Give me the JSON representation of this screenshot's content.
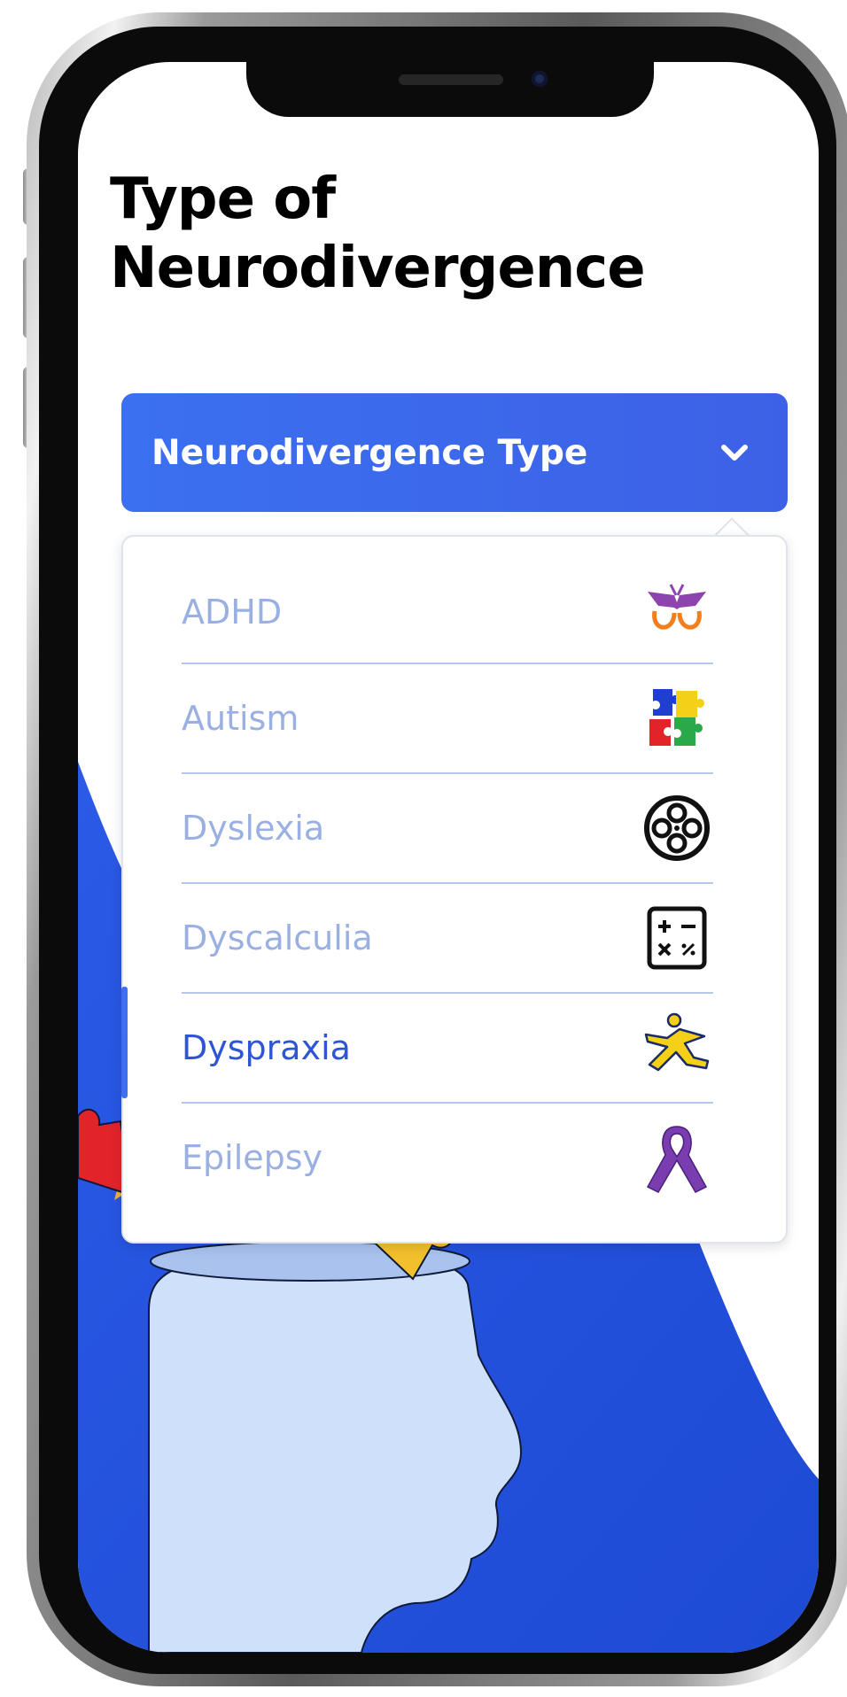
{
  "page": {
    "title": "Type of Neurodivergence"
  },
  "dropdown": {
    "label": "Neurodivergence Type",
    "state": "expanded",
    "icon": "chevron-down-icon"
  },
  "options": [
    {
      "label": "ADHD",
      "icon": "butterfly-icon",
      "selected": false
    },
    {
      "label": "Autism",
      "icon": "puzzle-pieces-icon",
      "selected": false
    },
    {
      "label": "Dyslexia",
      "icon": "film-reel-icon",
      "selected": false
    },
    {
      "label": "Dyscalculia",
      "icon": "calculator-icon",
      "selected": false
    },
    {
      "label": "Dyspraxia",
      "icon": "person-jumping-icon",
      "selected": true
    },
    {
      "label": "Epilepsy",
      "icon": "awareness-ribbon-icon",
      "selected": false
    }
  ],
  "colors": {
    "accent": "#3b6ff0",
    "background_blue": "#1f4fd8",
    "option_text": "#9bb0e2",
    "option_text_selected": "#2f55d4",
    "head_fill": "#cfe0fb"
  }
}
